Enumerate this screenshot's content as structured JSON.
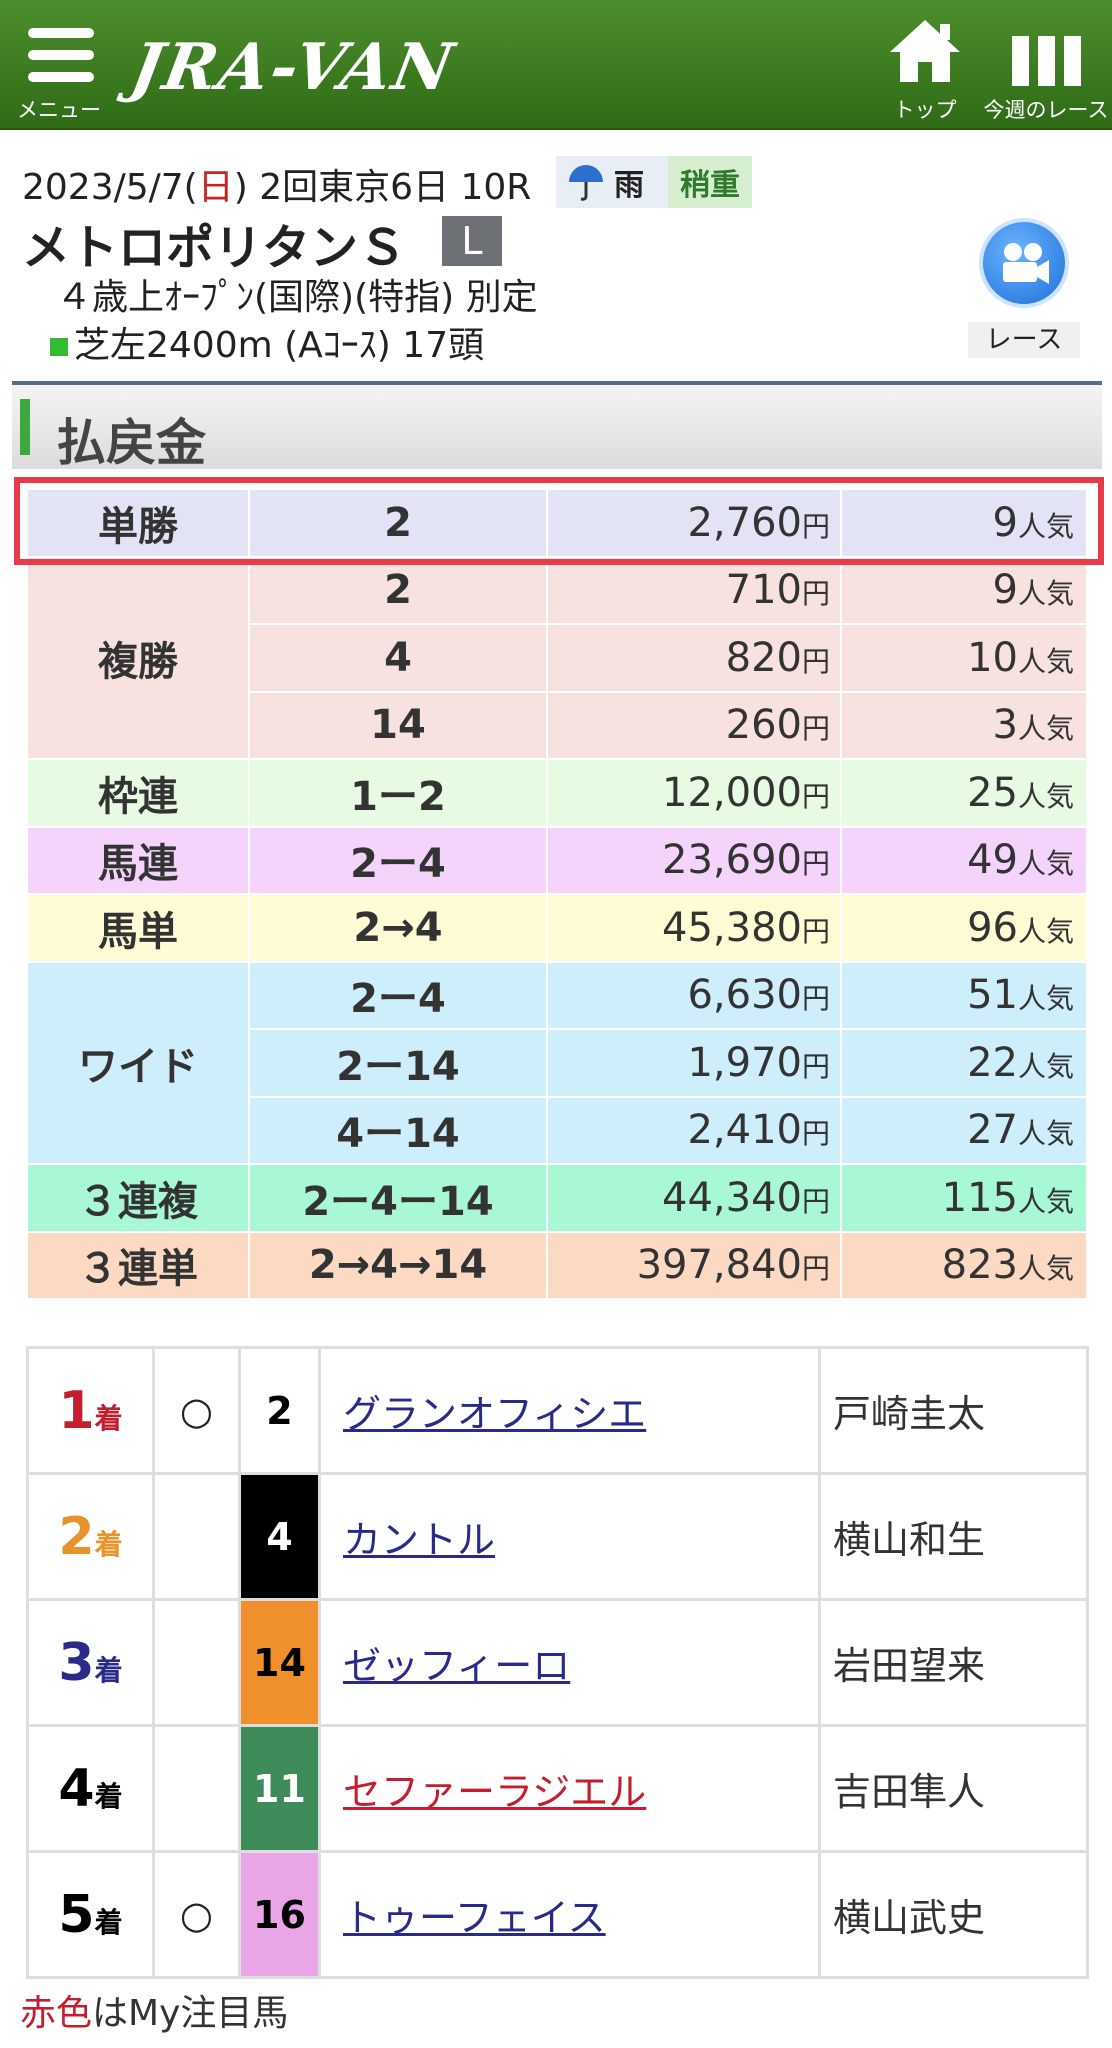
{
  "header": {
    "menu_label": "メニュー",
    "logo": "JRA-VAN",
    "top_label": "トップ",
    "week_label": "今週のレース",
    "bar_color": "#3b7d21"
  },
  "race": {
    "date_prefix": "2023/5/7(",
    "weekday": "日",
    "date_suffix": ") 2回東京6日 10R",
    "weather": "雨",
    "track_condition": "稍重",
    "name": "メトロポリタンＳ",
    "grade": "L",
    "conditions": "４歳上ｵｰﾌﾟﾝ(国際)(特指) 別定",
    "course": "芝左2400m (Aｺｰｽ) 17頭",
    "video_label": "レース"
  },
  "payout": {
    "title": "払戻金",
    "yen": "円",
    "ninki": "人気",
    "bets": [
      {
        "type": "単勝",
        "rows": [
          {
            "combo": "2",
            "amount": "2,760",
            "pop": "9"
          }
        ]
      },
      {
        "type": "複勝",
        "rows": [
          {
            "combo": "2",
            "amount": "710",
            "pop": "9"
          },
          {
            "combo": "4",
            "amount": "820",
            "pop": "10"
          },
          {
            "combo": "14",
            "amount": "260",
            "pop": "3"
          }
        ]
      },
      {
        "type": "枠連",
        "rows": [
          {
            "combo": "1ー2",
            "amount": "12,000",
            "pop": "25"
          }
        ]
      },
      {
        "type": "馬連",
        "rows": [
          {
            "combo": "2ー4",
            "amount": "23,690",
            "pop": "49"
          }
        ]
      },
      {
        "type": "馬単",
        "rows": [
          {
            "combo": "2→4",
            "amount": "45,380",
            "pop": "96"
          }
        ]
      },
      {
        "type": "ワイド",
        "rows": [
          {
            "combo": "2ー4",
            "amount": "6,630",
            "pop": "51"
          },
          {
            "combo": "2ー14",
            "amount": "1,970",
            "pop": "22"
          },
          {
            "combo": "4ー14",
            "amount": "2,410",
            "pop": "27"
          }
        ]
      },
      {
        "type": "３連複",
        "rows": [
          {
            "combo": "2ー4ー14",
            "amount": "44,340",
            "pop": "115"
          }
        ]
      },
      {
        "type": "３連単",
        "rows": [
          {
            "combo": "2→4→14",
            "amount": "397,840",
            "pop": "823"
          }
        ]
      }
    ]
  },
  "results": {
    "rank_unit": "着",
    "rows": [
      {
        "rank": "1",
        "mark": "○",
        "no": "2",
        "name": "グランオフィシエ",
        "jockey": "戸崎圭太",
        "rank_color": "#c41e2e",
        "frame_color": "#ffffff",
        "no_color": "#000000"
      },
      {
        "rank": "2",
        "mark": "",
        "no": "4",
        "name": "カントル",
        "jockey": "横山和生",
        "rank_color": "#e8922a",
        "frame_color": "#000000",
        "no_color": "#ffffff"
      },
      {
        "rank": "3",
        "mark": "",
        "no": "14",
        "name": "ゼッフィーロ",
        "jockey": "岩田望来",
        "rank_color": "#2a2a8a",
        "frame_color": "#f0902d",
        "no_color": "#000000"
      },
      {
        "rank": "4",
        "mark": "",
        "no": "11",
        "name": "セファーラジエル",
        "jockey": "吉田隼人",
        "rank_color": "#000000",
        "frame_color": "#3e8a5a",
        "no_color": "#ffffff"
      },
      {
        "rank": "5",
        "mark": "○",
        "no": "16",
        "name": "トゥーフェイス",
        "jockey": "横山武史",
        "rank_color": "#000000",
        "frame_color": "#e8a6e6",
        "no_color": "#000000"
      }
    ]
  },
  "note": {
    "red_text": "赤色",
    "rest": "はMy注目馬"
  }
}
